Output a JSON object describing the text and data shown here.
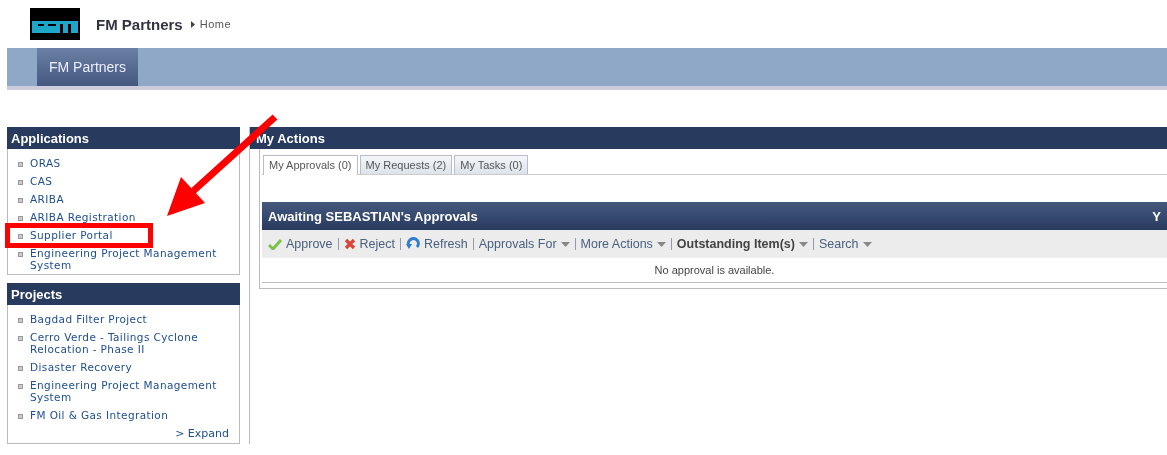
{
  "header": {
    "site_title": "FM Partners",
    "breadcrumb": "Home"
  },
  "nav": {
    "tabs": [
      {
        "label": "FM Partners",
        "selected": true
      }
    ]
  },
  "sidebar": {
    "panels": [
      {
        "title": "Applications",
        "items": [
          {
            "label": "ORAS"
          },
          {
            "label": "CAS"
          },
          {
            "label": "ARIBA"
          },
          {
            "label": "ARIBA Registration"
          },
          {
            "label": "Supplier Portal",
            "highlighted": true
          },
          {
            "label": "Engineering Project Management System"
          }
        ]
      },
      {
        "title": "Projects",
        "items": [
          {
            "label": "Bagdad Filter Project"
          },
          {
            "label": "Cerro Verde - Tailings Cyclone Relocation - Phase II"
          },
          {
            "label": "Disaster Recovery"
          },
          {
            "label": "Engineering Project Management System"
          },
          {
            "label": "FM Oil & Gas Integration"
          }
        ],
        "expand_link": "> Expand"
      }
    ]
  },
  "main": {
    "title": "My Actions",
    "tabs": [
      {
        "label": "My Approvals (0)",
        "selected": true
      },
      {
        "label": "My Requests (2)",
        "selected": false
      },
      {
        "label": "My Tasks (0)",
        "selected": false
      }
    ],
    "grid": {
      "title": "Awaiting SEBASTIAN's Approvals",
      "title_right": "Y",
      "actions": [
        {
          "kind": "approve",
          "label": "Approve",
          "selected": false
        },
        {
          "kind": "reject",
          "label": "Reject",
          "selected": false
        },
        {
          "kind": "refresh",
          "label": "Refresh",
          "selected": false
        },
        {
          "kind": "menu",
          "label": "Approvals For",
          "selected": false
        },
        {
          "kind": "menu",
          "label": "More Actions",
          "selected": false
        },
        {
          "kind": "menu",
          "label": "Outstanding Item(s)",
          "selected": true
        },
        {
          "kind": "menu",
          "label": "Search",
          "selected": false
        }
      ],
      "empty_message": "No approval is available."
    }
  },
  "pointer_arrow": true
}
